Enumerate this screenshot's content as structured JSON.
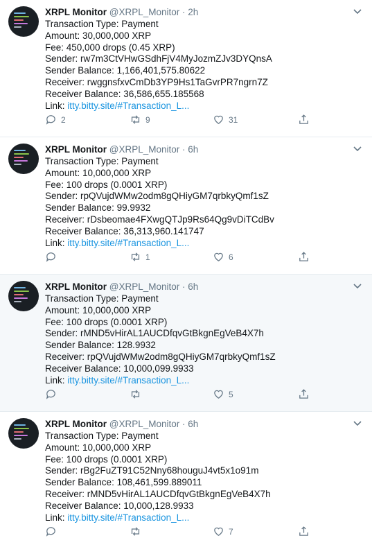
{
  "colors": {
    "accent": "#1b95e0",
    "text": "#14171a",
    "muted": "#657786",
    "hover_bg": "#f5f8fa"
  },
  "icons": {
    "reply": "reply-icon",
    "retweet": "retweet-icon",
    "like": "heart-icon",
    "share": "share-icon",
    "more": "chevron-down-icon"
  },
  "tweets": [
    {
      "name": "XRPL Monitor",
      "handle": "@XRPL_Monitor",
      "dot": "·",
      "time": "2h",
      "lines": [
        "Transaction Type: Payment",
        "Amount: 30,000,000 XRP",
        "Fee: 450,000 drops (0.45 XRP)",
        "Sender: rw7m3CtVHwGSdhFjV4MyJozmZJv3DYQnsA",
        "Sender Balance: 1,166,401,575.80622",
        "Receiver: rwggnsfxvCmDb3YP9Hs1TaGvrPR7ngrn7Z",
        "Receiver Balance: 36,586,655.185568"
      ],
      "link_label": "Link: ",
      "link_text": "itty.bitty.site/#Transaction_L...",
      "replies": "2",
      "retweets": "9",
      "likes": "31"
    },
    {
      "name": "XRPL Monitor",
      "handle": "@XRPL_Monitor",
      "dot": "·",
      "time": "6h",
      "lines": [
        "Transaction Type: Payment",
        "Amount: 10,000,000 XRP",
        "Fee: 100 drops (0.0001 XRP)",
        "Sender: rpQVujdWMw2odm8gQHiyGM7qrbkyQmf1sZ",
        "Sender Balance: 99.9932",
        "Receiver: rDsbeomae4FXwgQTJp9Rs64Qg9vDiTCdBv",
        "Receiver Balance: 36,313,960.141747"
      ],
      "link_label": "Link: ",
      "link_text": "itty.bitty.site/#Transaction_L...",
      "replies": "",
      "retweets": "1",
      "likes": "6"
    },
    {
      "name": "XRPL Monitor",
      "handle": "@XRPL_Monitor",
      "dot": "·",
      "time": "6h",
      "lines": [
        "Transaction Type: Payment",
        "Amount: 10,000,000 XRP",
        "Fee: 100 drops (0.0001 XRP)",
        "Sender: rMND5vHirAL1AUCDfqvGtBkgnEgVeB4X7h",
        "Sender Balance: 128.9932",
        "Receiver: rpQVujdWMw2odm8gQHiyGM7qrbkyQmf1sZ",
        "Receiver Balance: 10,000,099.9933"
      ],
      "link_label": "Link: ",
      "link_text": "itty.bitty.site/#Transaction_L...",
      "replies": "",
      "retweets": "",
      "likes": "5"
    },
    {
      "name": "XRPL Monitor",
      "handle": "@XRPL_Monitor",
      "dot": "·",
      "time": "6h",
      "lines": [
        "Transaction Type: Payment",
        "Amount: 10,000,000 XRP",
        "Fee: 100 drops (0.0001 XRP)",
        "Sender: rBg2FuZT91C52Nny68houguJ4vt5x1o91m",
        "Sender Balance: 108,461,599.889011",
        "Receiver: rMND5vHirAL1AUCDfqvGtBkgnEgVeB4X7h",
        "Receiver Balance: 10,000,128.9933"
      ],
      "link_label": "Link: ",
      "link_text": "itty.bitty.site/#Transaction_L...",
      "replies": "",
      "retweets": "",
      "likes": "7"
    }
  ]
}
